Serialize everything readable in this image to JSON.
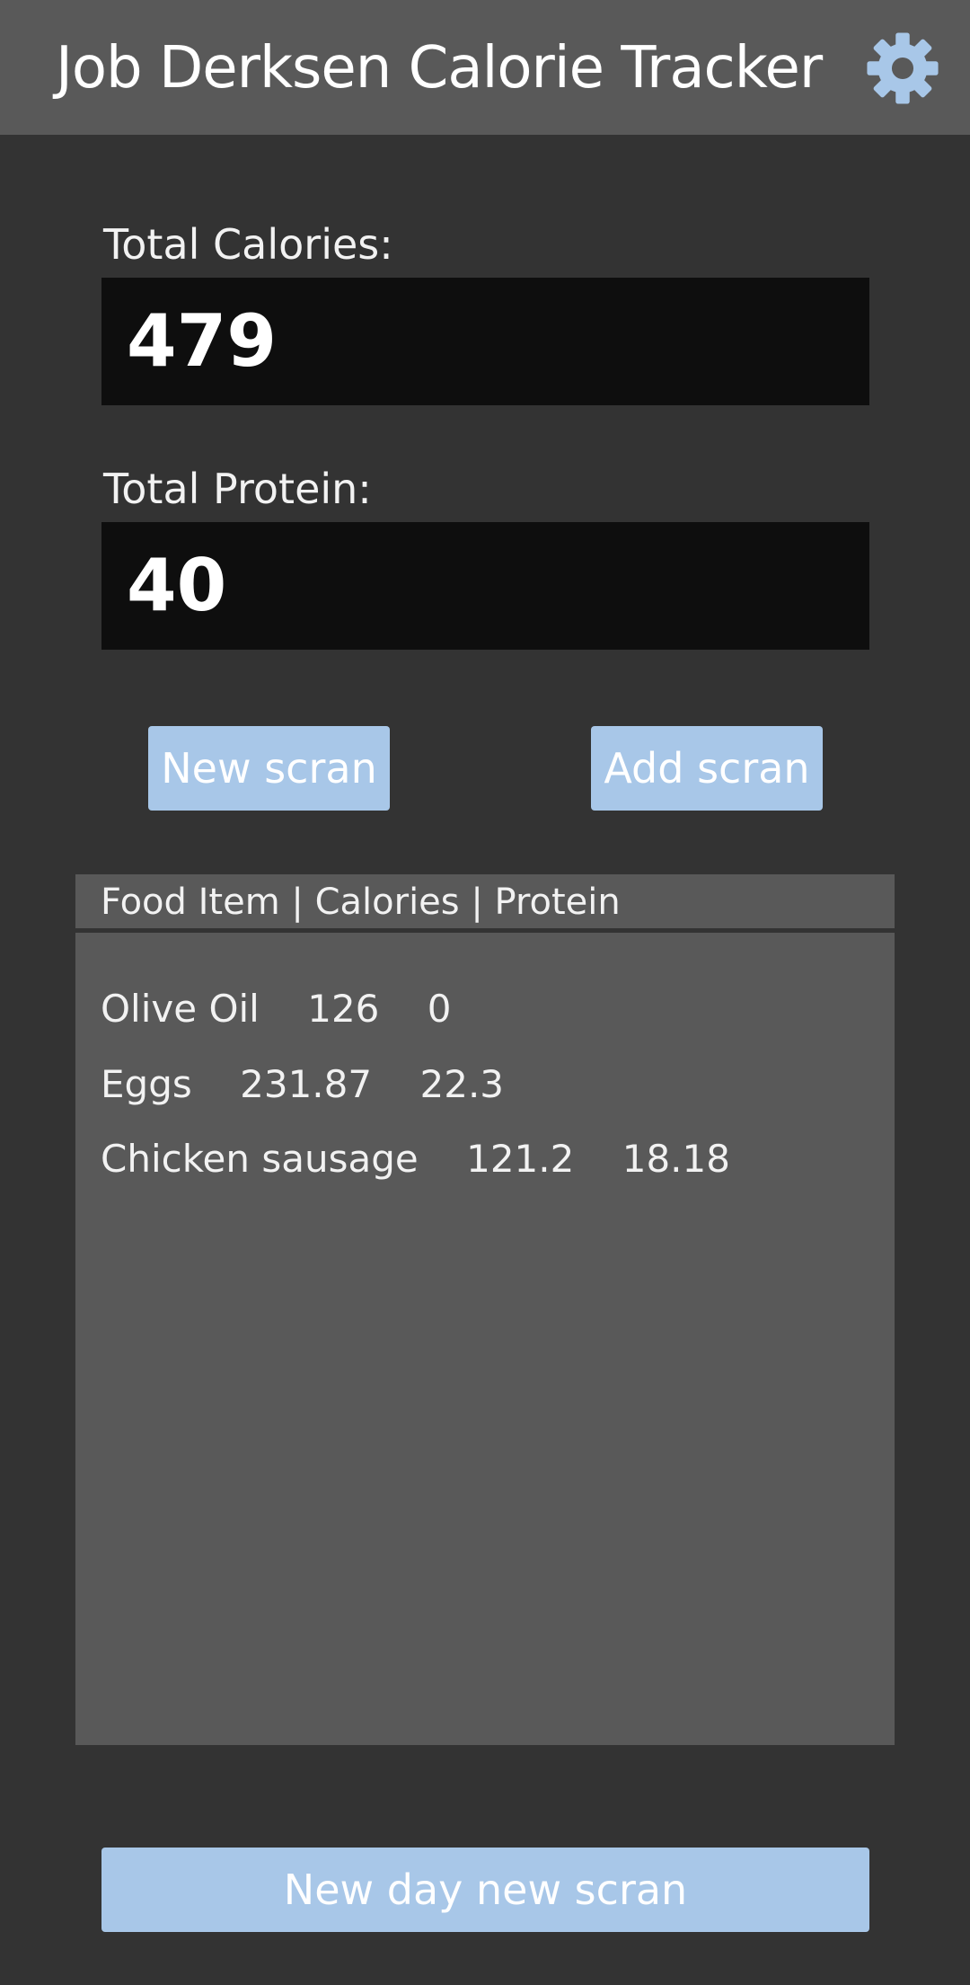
{
  "header": {
    "title": "Job Derksen Calorie Tracker",
    "settings_icon": "gear-icon"
  },
  "totals": {
    "calories_label": "Total Calories:",
    "calories_value": "479",
    "protein_label": "Total Protein:",
    "protein_value": "40"
  },
  "actions": {
    "new_scran": "New scran",
    "add_scran": "Add scran",
    "new_day": "New day new scran"
  },
  "food_list": {
    "header": "Food Item | Calories | Protein",
    "items": [
      {
        "text": "Olive Oil    126    0"
      },
      {
        "text": "Eggs    231.87    22.3"
      },
      {
        "text": "Chicken sausage    121.2    18.18"
      }
    ]
  },
  "colors": {
    "background": "#333333",
    "header": "#595959",
    "accent": "#a8c7e8",
    "value_box": "#0e0e0e"
  }
}
